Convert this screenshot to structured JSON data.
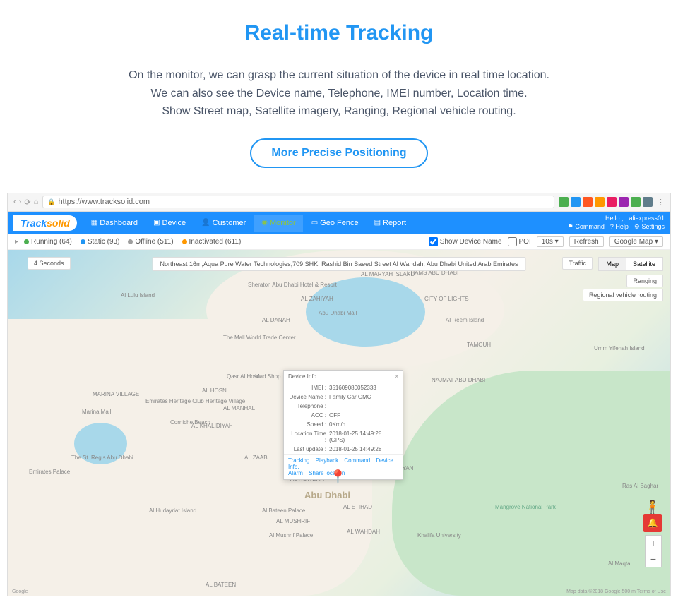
{
  "hero": {
    "title": "Real-time Tracking",
    "desc_line1": "On the monitor, we can grasp the current situation of the device in real time location.",
    "desc_line2": "We can also see the Device name, Telephone, IMEI number, Location time.",
    "desc_line3": "Show Street map, Satellite imagery, Ranging, Regional vehicle routing.",
    "cta": "More Precise Positioning"
  },
  "browser": {
    "url": "https://www.tracksolid.com"
  },
  "logo": {
    "track": "Track",
    "solid": "solid"
  },
  "nav": {
    "dashboard": "Dashboard",
    "device": "Device",
    "customer": "Customer",
    "monitor": "Monitor",
    "geofence": "Geo Fence",
    "report": "Report"
  },
  "user": {
    "hello": "Hello ,",
    "name": "aliexpress01",
    "command": "Command",
    "help": "Help",
    "settings": "Settings"
  },
  "status": {
    "running": "Running (64)",
    "static": "Static (93)",
    "offline": "Offline (511)",
    "inactivated": "Inactivated (611)",
    "show_device": "Show Device Name",
    "poi": "POI",
    "interval": "10s",
    "refresh": "Refresh",
    "mapsrc": "Google Map"
  },
  "map": {
    "seconds": "4 Seconds",
    "address": "Northeast 16m,Aqua Pure Water Technologies,709 SHK. Rashid Bin Saeed Street Al Wahdah, Abu Dhabi United Arab Emirates",
    "traffic": "Traffic",
    "map": "Map",
    "satellite": "Satellite",
    "ranging": "Ranging",
    "routing": "Regional vehicle routing",
    "attrib_l": "Google",
    "attrib_r": "Map data ©2018 Google   500 m   Terms of Use"
  },
  "popup": {
    "title": "Device Info.",
    "imei_lbl": "IMEI :",
    "imei": "351609080052333",
    "name_lbl": "Device Name :",
    "name": "Family Car GMC",
    "tel_lbl": "Telephone :",
    "tel": "",
    "acc_lbl": "ACC :",
    "acc": "OFF",
    "speed_lbl": "Speed :",
    "speed": "0Km/h",
    "loc_lbl": "Location Time :",
    "loc": "2018-01-25 14:49:28 (GPS)",
    "upd_lbl": "Last update :",
    "upd": "2018-01-25 14:49:28",
    "tracking": "Tracking",
    "playback": "Playback",
    "command": "Command",
    "devinfo": "Device Info.",
    "alarm": "Alarm",
    "share": "Share location"
  },
  "labels": {
    "abudhabi": "Abu Dhabi",
    "marina": "MARINA VILLAGE",
    "emirates": "Emirates Palace",
    "corniche": "Corniche Beach",
    "alreem": "Al Reem Island",
    "mangrove": "Mangrove National Park",
    "maryah": "AL MARYAH ISLAND",
    "sheraton": "Sheraton Abu Dhabi Hotel & Resort",
    "lulu": "Al Lulu Island",
    "mall": "Abu Dhabi Mall",
    "twtc": "The Mall World Trade Center",
    "qasr": "Qasr Al Hosn",
    "heritage": "Emirates Heritage Club Heritage Village",
    "regis": "The St. Regis Abu Dhabi",
    "bateen": "AL BATEEN",
    "rowdah": "AL ROWDAH",
    "mushrif": "AL MUSHRIF",
    "khalidiyah": "AL KHALIDIYAH",
    "manhal": "AL MANHAL",
    "zaab": "AL ZAAB",
    "danah": "AL DANAH",
    "zahiyah": "AL ZAHIYAH",
    "nahyan": "AL NAHYAN",
    "hosn": "AL HOSN",
    "etihad": "AL ETIHAD",
    "wahdah": "AL WAHDAH",
    "tamouh": "TAMOUH",
    "najmat": "NAJMAT ABU DHABI",
    "city": "CITY OF LIGHTS",
    "khalifa": "Khalifa University",
    "umm": "Umm Yifenah Island",
    "bateen_palace": "Al Bateen Palace",
    "mushrif_palace": "Al Mushrif Palace",
    "shams": "SHAMS ABU DHABI",
    "hudayriat": "Al Hudayriat Island",
    "bahr": "Ras Al Baghar",
    "madshop": "Mad Shop",
    "maqta": "Al Maqta",
    "marina_mall": "Marina Mall"
  }
}
